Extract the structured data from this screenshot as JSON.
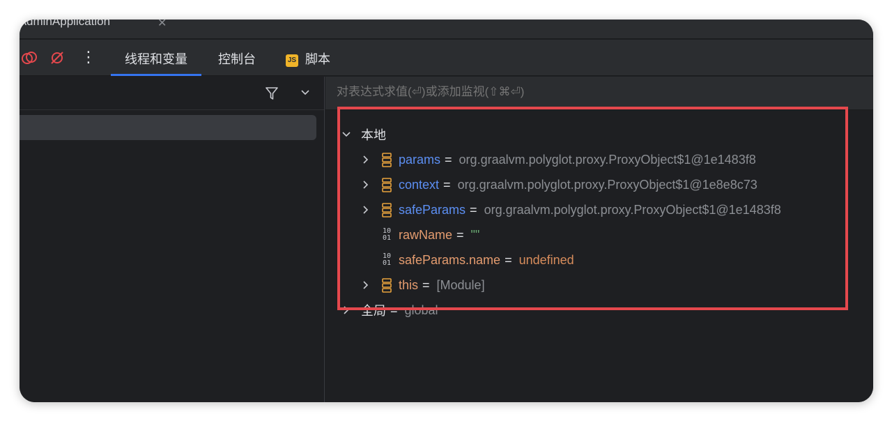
{
  "window": {
    "tab_title": "tAdminApplication",
    "tab_close": "✕"
  },
  "toolbar": {
    "more": "⋮",
    "tabs": [
      {
        "label": "线程和变量",
        "active": true
      },
      {
        "label": "控制台",
        "active": false
      },
      {
        "label": "脚本",
        "active": false,
        "badge": "JS"
      }
    ]
  },
  "evaluate": {
    "placeholder": "对表达式求值(⏎)或添加监视(⇧⌘⏎)"
  },
  "variables": {
    "local_label": "本地",
    "items": [
      {
        "name": "params",
        "eq": "=",
        "value": "org.graalvm.polyglot.proxy.ProxyObject$1@1e1483f8"
      },
      {
        "name": "context",
        "eq": "=",
        "value": "org.graalvm.polyglot.proxy.ProxyObject$1@1e8e8c73"
      },
      {
        "name": "safeParams",
        "eq": "=",
        "value": "org.graalvm.polyglot.proxy.ProxyObject$1@1e1483f8"
      },
      {
        "name": "rawName",
        "eq": "=",
        "value": "\"\""
      },
      {
        "name": "safeParams.name",
        "eq": "=",
        "value": "undefined"
      },
      {
        "name": "this",
        "eq": "=",
        "value": "[Module]"
      }
    ],
    "global_label": "全局",
    "global_eq": "=",
    "global_value": "global",
    "binary_icon_text": "10\n01"
  },
  "colors": {
    "accent": "#3574f0",
    "highlight_border": "#e5484d",
    "object_icon": "#e8a33d",
    "var_blue": "#5c8ff3",
    "var_orange": "#e49c6f"
  }
}
